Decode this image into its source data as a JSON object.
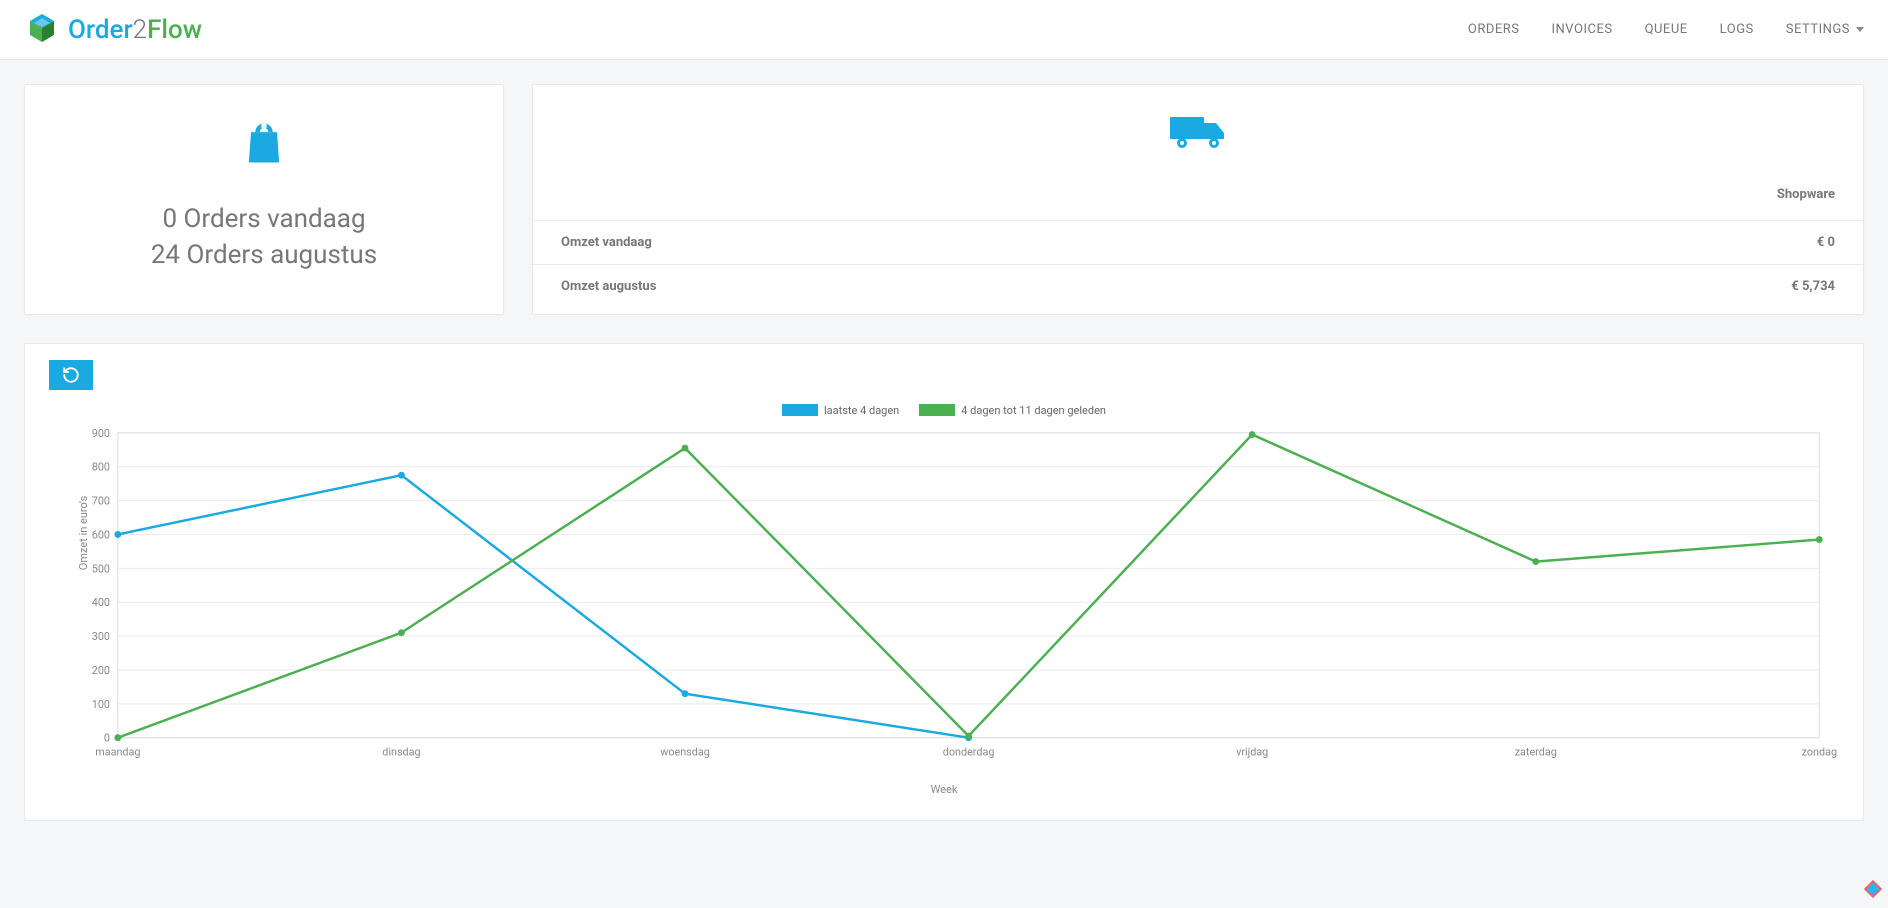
{
  "brand": {
    "part1": "Order",
    "part2": "2",
    "part3": "Flow"
  },
  "nav": {
    "orders": "ORDERS",
    "invoices": "INVOICES",
    "queue": "QUEUE",
    "logs": "LOGS",
    "settings": "SETTINGS"
  },
  "orders_card": {
    "line1": "0 Orders vandaag",
    "line2": "24 Orders augustus"
  },
  "revenue_card": {
    "shop": "Shopware",
    "rows": [
      {
        "label": "Omzet vandaag",
        "value": "€ 0"
      },
      {
        "label": "Omzet augustus",
        "value": "€ 5,734"
      }
    ]
  },
  "chart_data": {
    "type": "line",
    "title": "",
    "xlabel": "Week",
    "ylabel": "Omzet in euro's",
    "categories": [
      "maandag",
      "dinsdag",
      "woensdag",
      "donderdag",
      "vrijdag",
      "zaterdag",
      "zondag"
    ],
    "ylim": [
      0,
      900
    ],
    "yticks": [
      0,
      100,
      200,
      300,
      400,
      500,
      600,
      700,
      800,
      900
    ],
    "series": [
      {
        "name": "laatste 4 dagen",
        "color": "#1ba9e1",
        "values": [
          600,
          775,
          130,
          0,
          null,
          null,
          null
        ]
      },
      {
        "name": "4 dagen tot 11 dagen geleden",
        "color": "#4caf50",
        "values": [
          0,
          310,
          855,
          5,
          895,
          520,
          585
        ]
      }
    ]
  }
}
